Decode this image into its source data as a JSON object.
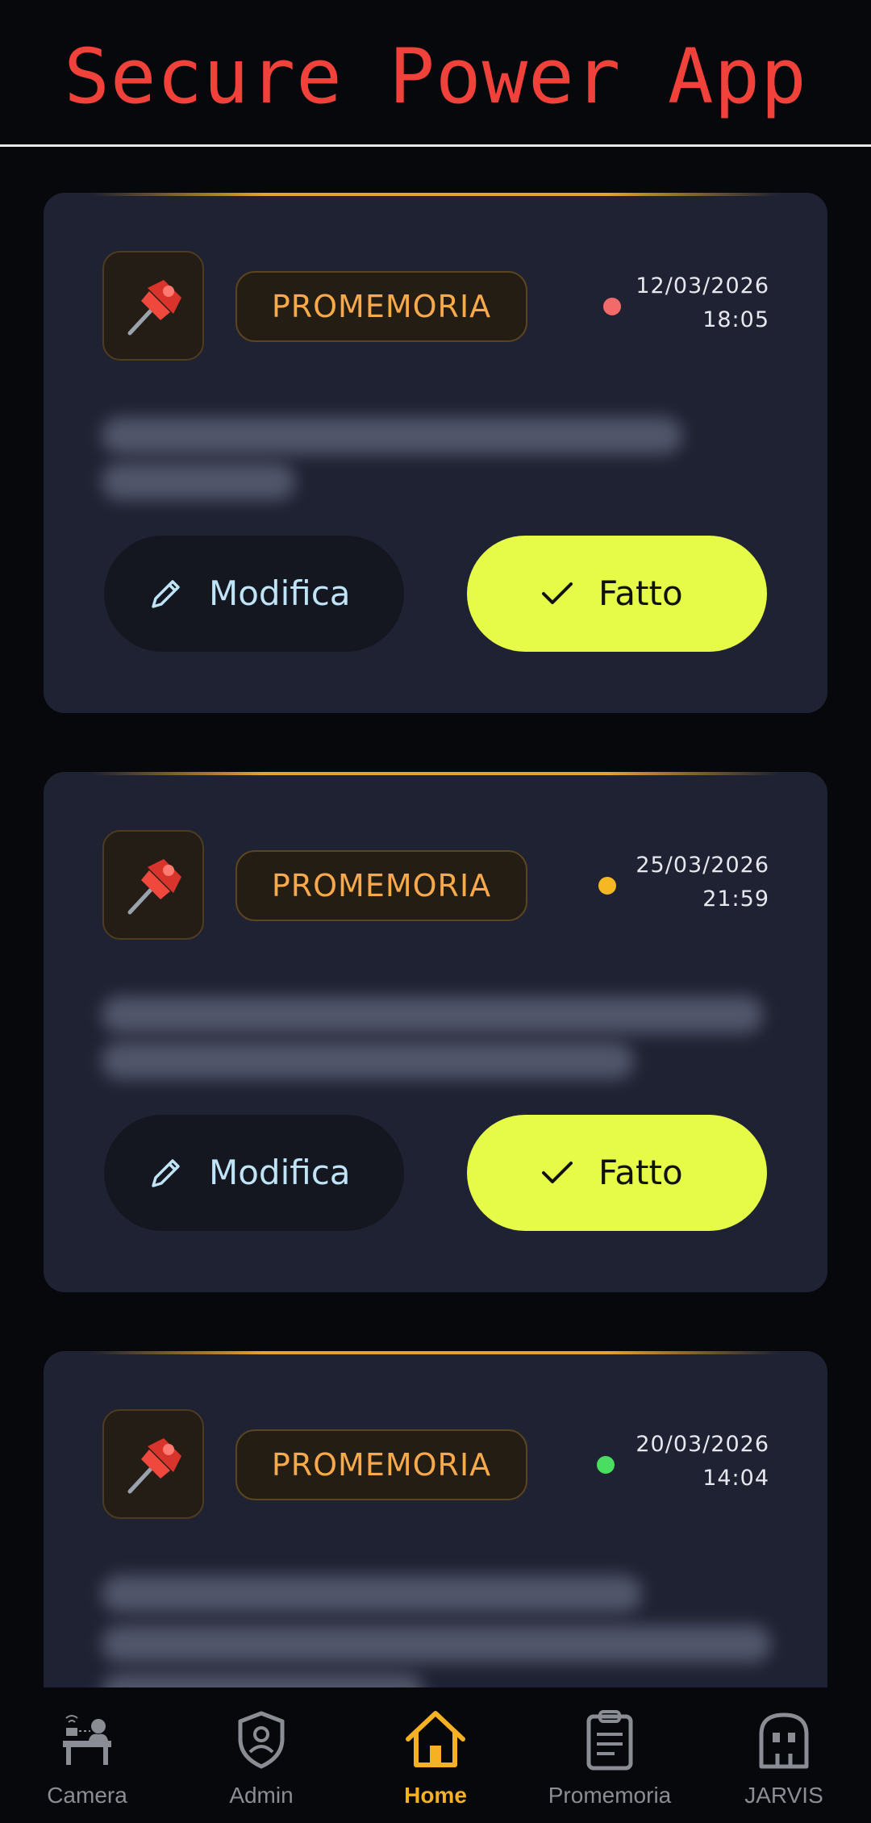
{
  "header": {
    "title": "Secure Power App"
  },
  "cards": [
    {
      "tag": "PROMEMORIA",
      "date": "12/03/2026",
      "time": "18:05",
      "status_color": "#f26a6a",
      "edit_label": "Modifica",
      "done_label": "Fatto"
    },
    {
      "tag": "PROMEMORIA",
      "date": "25/03/2026",
      "time": "21:59",
      "status_color": "#f5b823",
      "edit_label": "Modifica",
      "done_label": "Fatto"
    },
    {
      "tag": "PROMEMORIA",
      "date": "20/03/2026",
      "time": "14:04",
      "status_color": "#4ade60",
      "edit_label": "Modifica",
      "done_label": "Fatto"
    }
  ],
  "nav": {
    "items": [
      {
        "label": "Camera",
        "icon": "camera-surveillance-icon",
        "active": false
      },
      {
        "label": "Admin",
        "icon": "shield-user-icon",
        "active": false
      },
      {
        "label": "Home",
        "icon": "home-icon",
        "active": true
      },
      {
        "label": "Promemoria",
        "icon": "clipboard-icon",
        "active": false
      },
      {
        "label": "JARVIS",
        "icon": "robot-icon",
        "active": false
      }
    ]
  },
  "colors": {
    "accent": "#e6fb47",
    "title_red": "#f0413a",
    "tag_orange": "#f7a94c",
    "nav_active": "#f6b023",
    "card_bg": "#1f2233"
  }
}
